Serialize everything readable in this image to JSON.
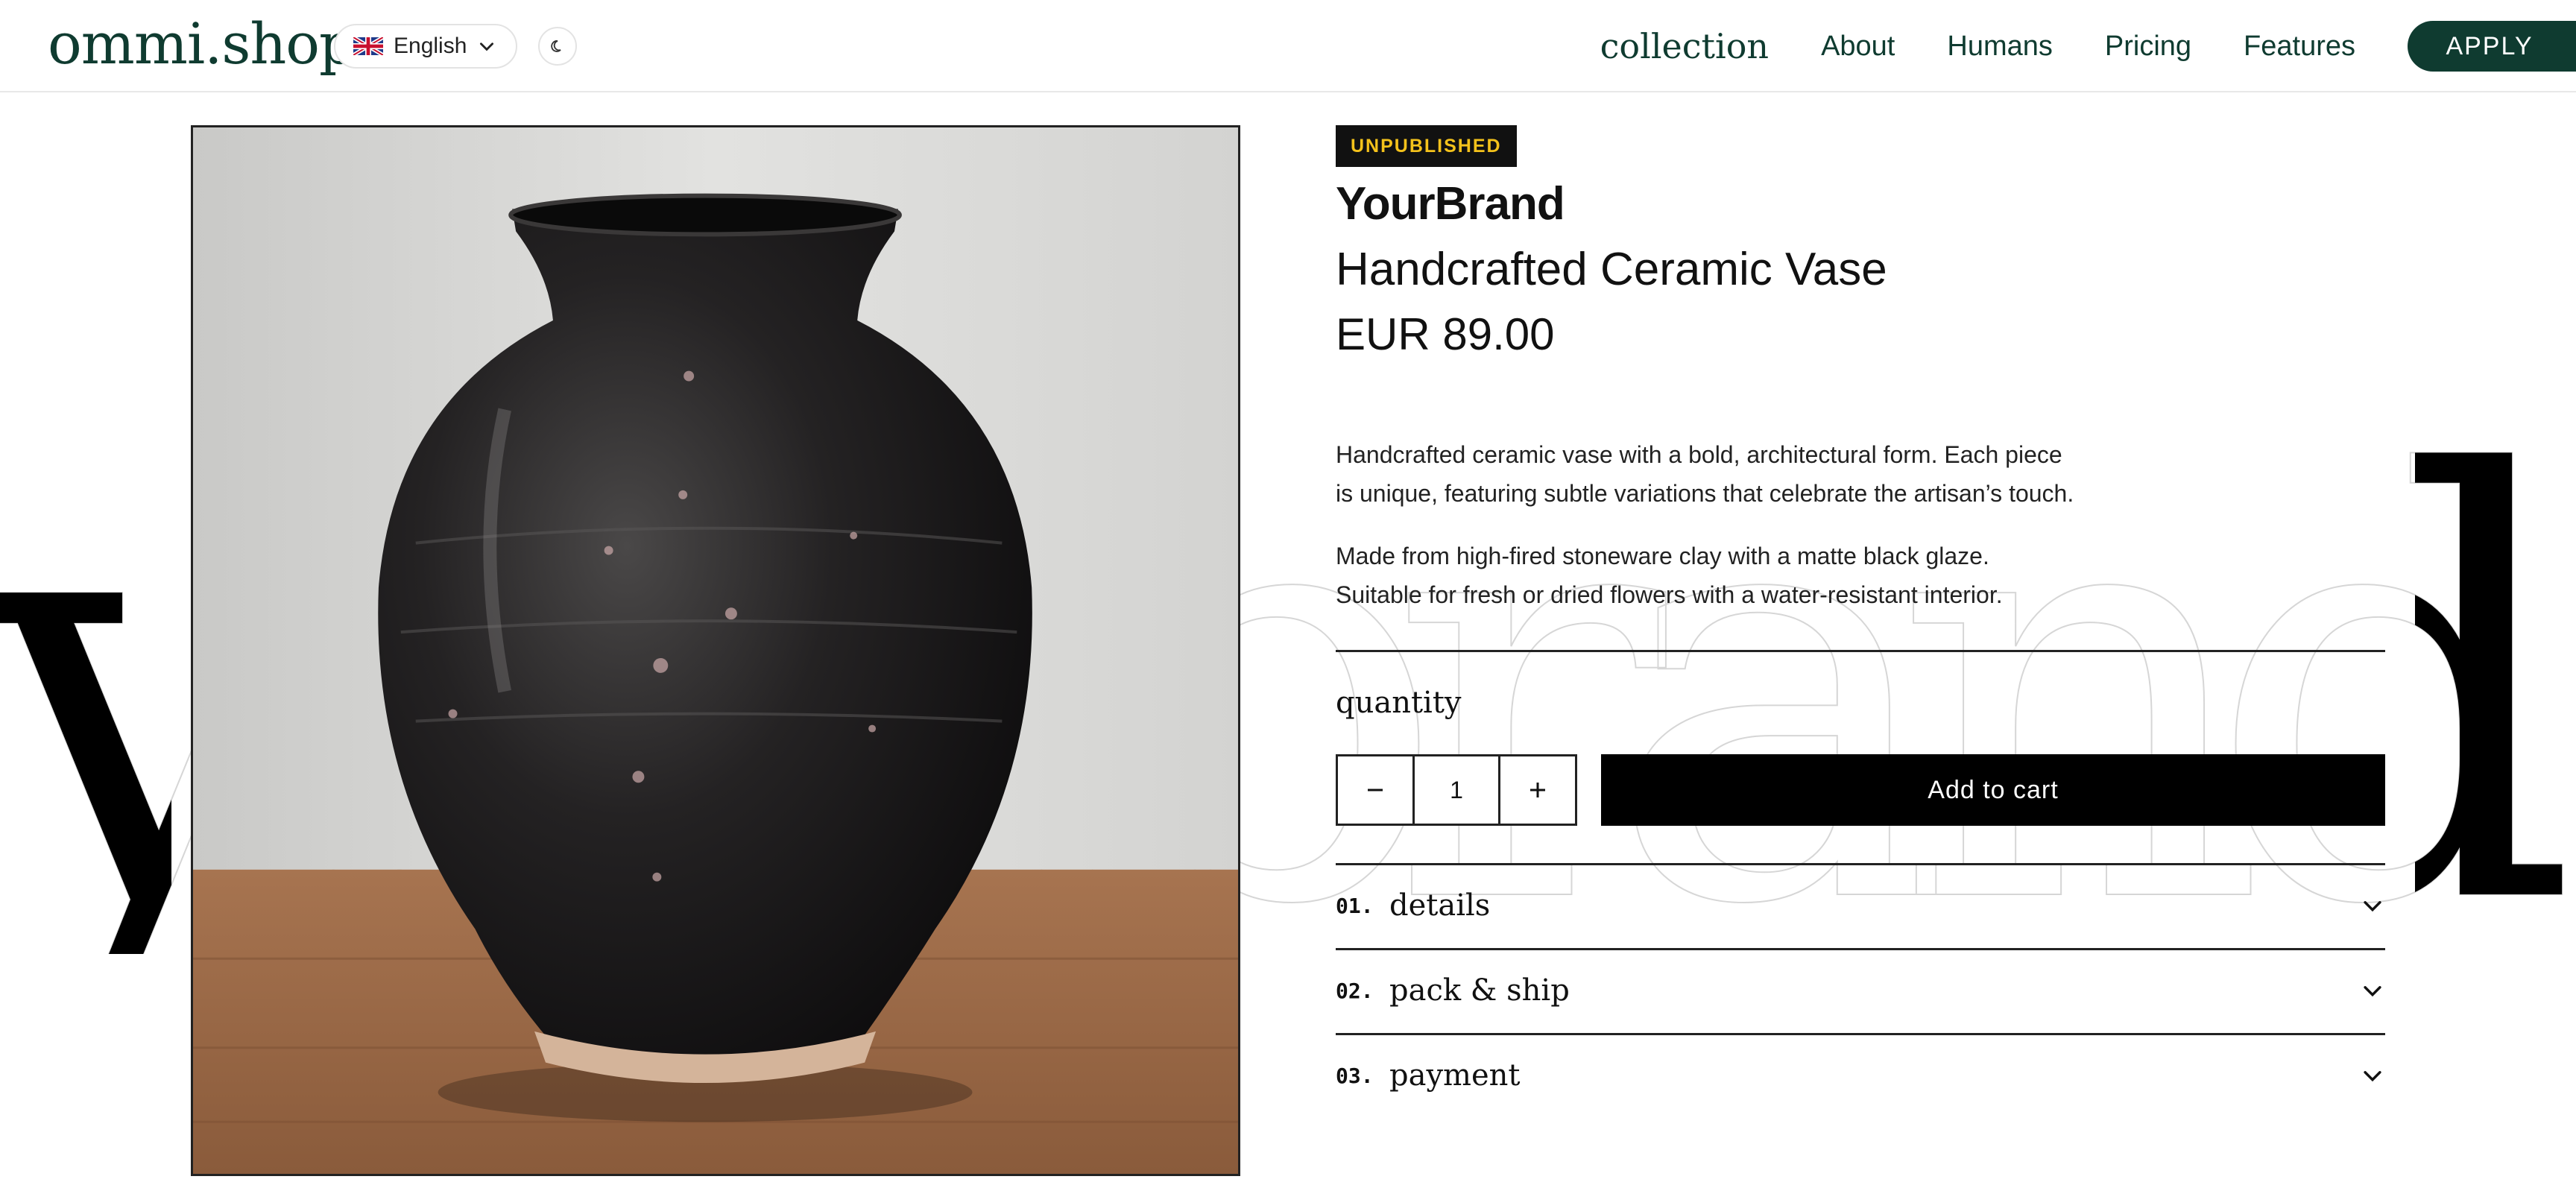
{
  "header": {
    "logo": "ommi.shop",
    "language": {
      "label": "English",
      "flag_icon": "uk-flag-icon"
    },
    "theme_toggle_icon": "moon-icon",
    "nav": [
      {
        "label": "collection"
      },
      {
        "label": "About"
      },
      {
        "label": "Humans"
      },
      {
        "label": "Pricing"
      },
      {
        "label": "Features"
      }
    ],
    "apply_label": "APPLY"
  },
  "background_wordmark": "yourbrand",
  "product": {
    "image_alt": "black ceramic vase",
    "badge": "UNPUBLISHED",
    "brand": "YourBrand",
    "title": "Handcrafted Ceramic Vase",
    "price": "EUR 89.00",
    "description": [
      [
        "Handcrafted ceramic vase with a bold, architectural form. Each piece",
        "is unique, featuring subtle variations that celebrate the artisan’s touch."
      ],
      [
        "Made from high-fired stoneware clay with a matte black glaze.",
        "Suitable for fresh or dried flowers with a water-resistant interior."
      ]
    ],
    "quantity_label": "quantity",
    "quantity_value": "1",
    "add_to_cart": "Add to cart",
    "accordion": [
      {
        "num": "01.",
        "label": "details"
      },
      {
        "num": "02.",
        "label": "pack & ship"
      },
      {
        "num": "03.",
        "label": "payment"
      }
    ]
  },
  "colors": {
    "brand_green": "#0f3b30",
    "badge_bg": "#111111",
    "badge_text": "#f4c21b",
    "button_black": "#000000"
  }
}
